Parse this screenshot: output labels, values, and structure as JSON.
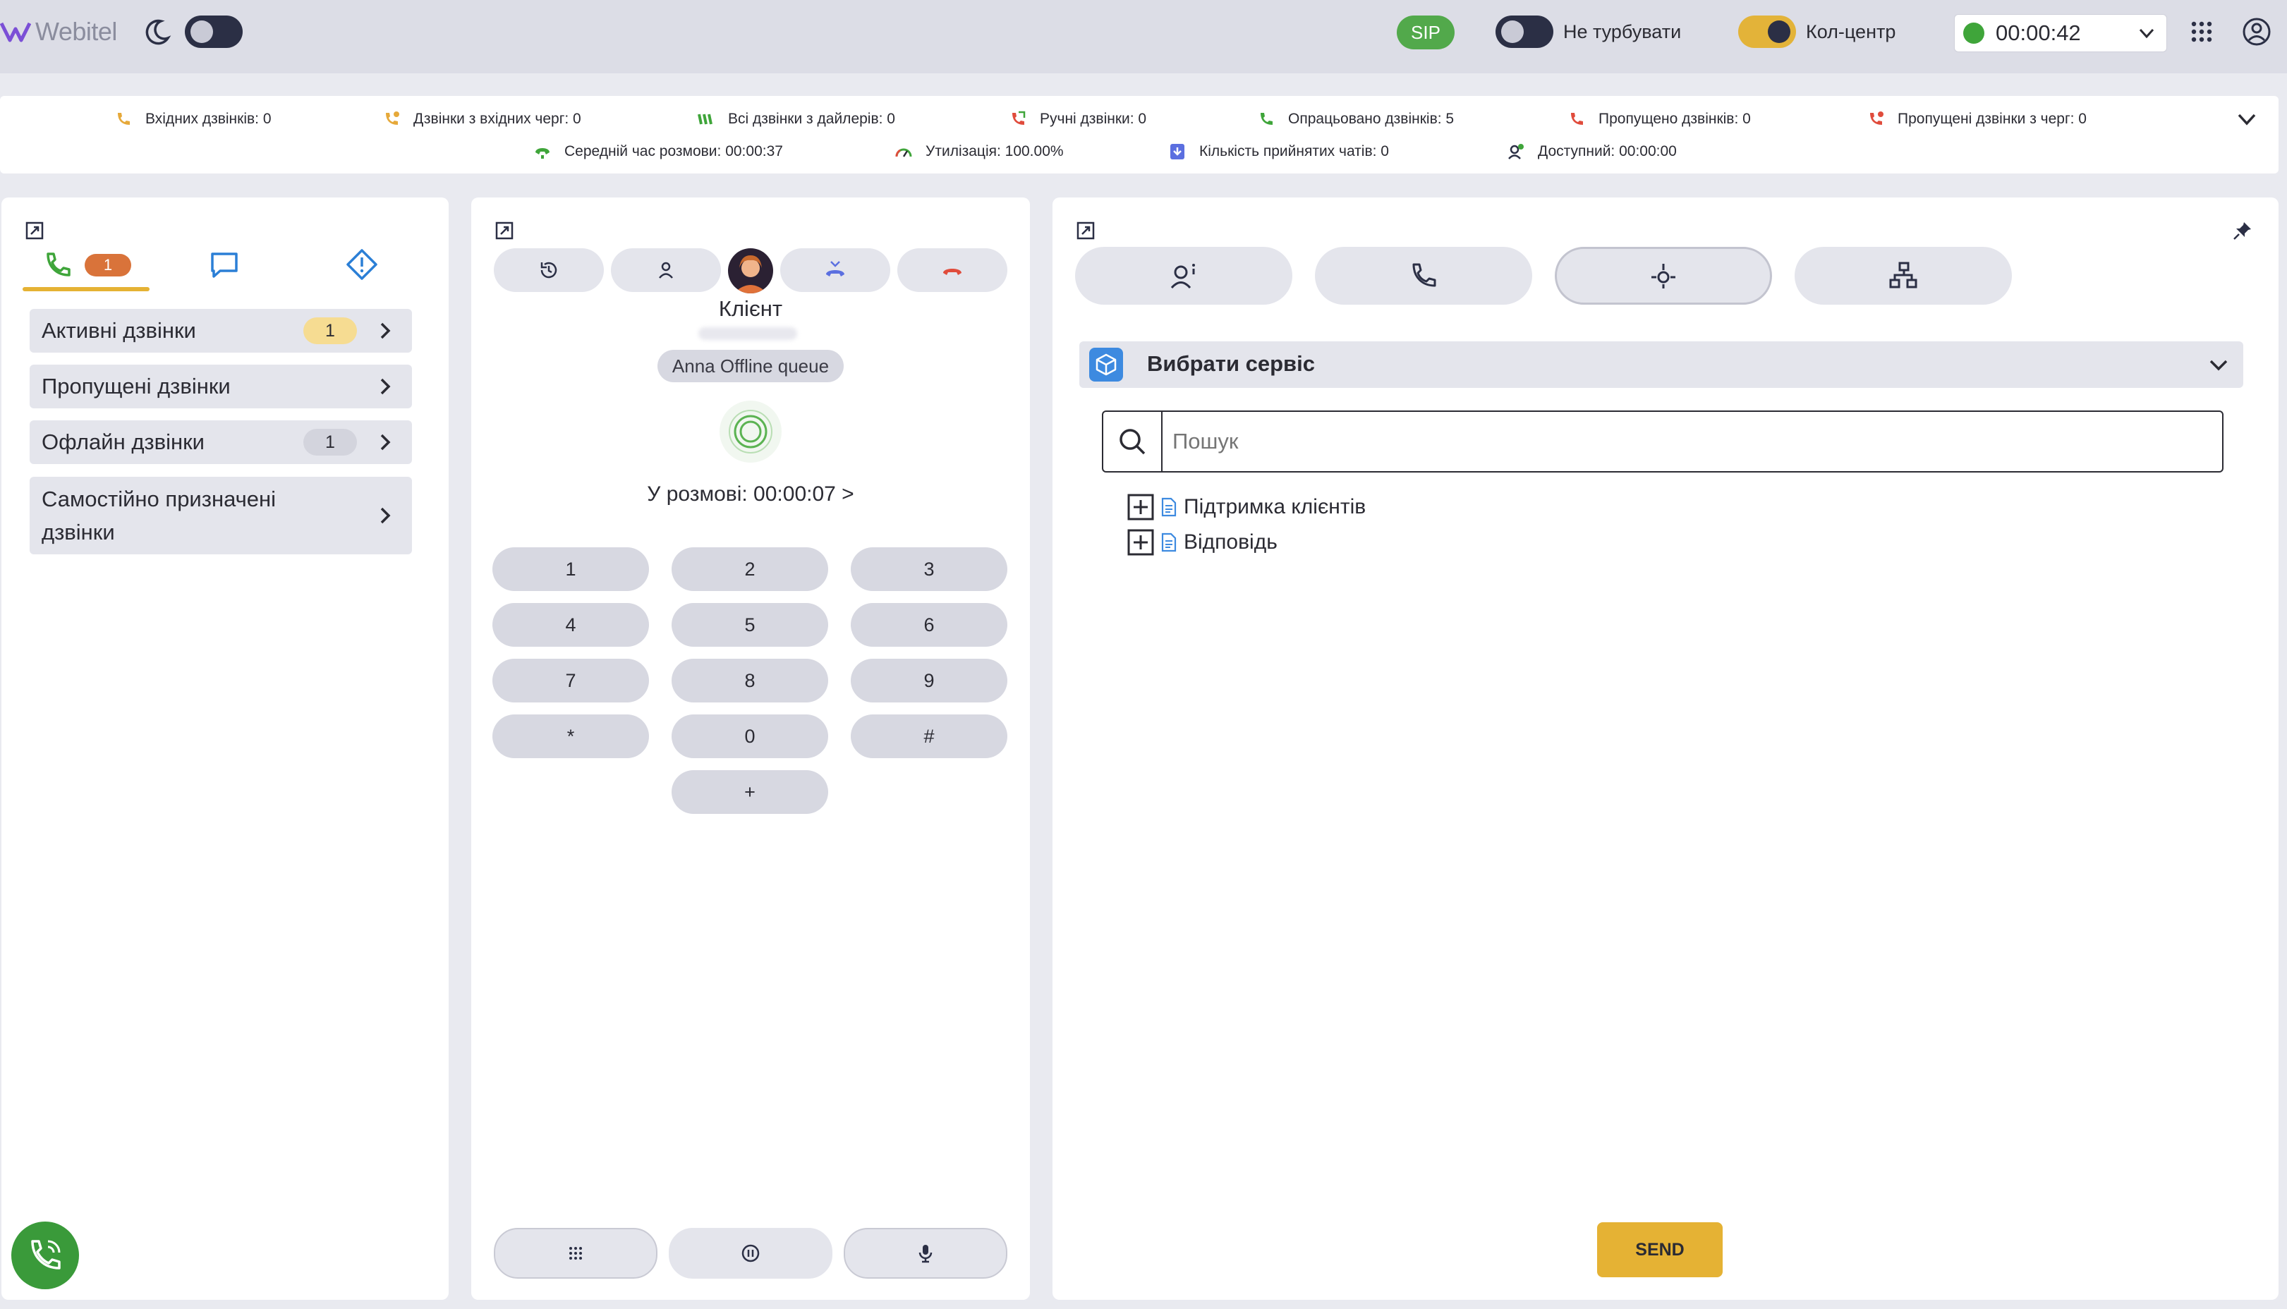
{
  "app": {
    "logo_text": "Webitel"
  },
  "topbar": {
    "sip_label": "SIP",
    "dnd_label": "Не турбувати",
    "callcenter_label": "Кол-центр",
    "status_time": "00:00:42",
    "colors": {
      "sip": "#52a94b",
      "accent": "#e3b339",
      "online": "#3fa53a"
    }
  },
  "stats": {
    "row1": [
      "Вхідних дзвінків: 0",
      "Дзвінки з вхідних черг: 0",
      "Всі дзвінки з дайлерів: 0",
      "Ручні дзвінки: 0",
      "Опрацьовано дзвінків: 5",
      "Пропущено дзвінків: 0",
      "Пропущені дзвінки з черг: 0"
    ],
    "row2": [
      "Середній час розмови: 00:00:37",
      "Утилізація: 100.00%",
      "Кількість прийнятих чатів: 0",
      "Доступний: 00:00:00"
    ]
  },
  "left": {
    "calls_tab_badge": "1",
    "items": [
      {
        "label": "Активні дзвінки",
        "count": "1"
      },
      {
        "label": "Пропущені дзвінки",
        "count": ""
      },
      {
        "label": "Офлайн дзвінки",
        "count": "1"
      },
      {
        "label_line1": "Самостійно призначені",
        "label_line2": "дзвінки"
      }
    ]
  },
  "middle": {
    "client_name": "Клієнт",
    "queue": "Anna Offline queue",
    "talk_time": "У розмові: 00:00:07 >",
    "keys": [
      "1",
      "2",
      "3",
      "4",
      "5",
      "6",
      "7",
      "8",
      "9",
      "*",
      "0",
      "#",
      "+"
    ]
  },
  "right": {
    "service_label": "Вибрати сервіс",
    "search_placeholder": "Пошук",
    "tree": [
      "Підтримка клієнтів",
      "Відповідь"
    ],
    "send_label": "SEND"
  }
}
